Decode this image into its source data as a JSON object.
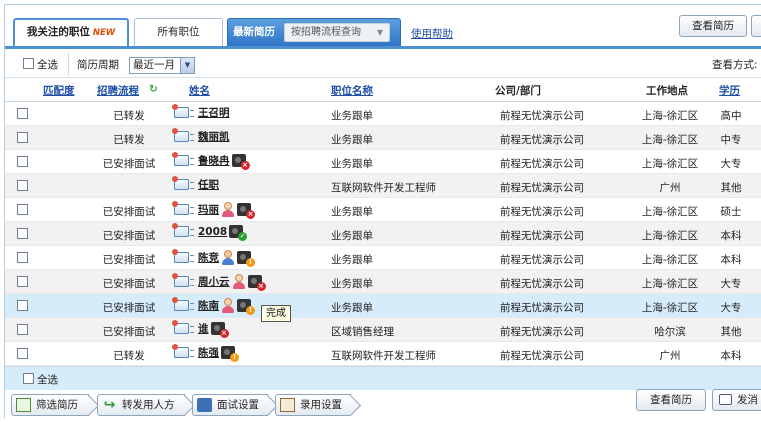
{
  "tabs": {
    "watched": {
      "label": "我关注的职位",
      "badge": "NEW"
    },
    "all": {
      "label": "所有职位"
    },
    "latest": {
      "label": "最新简历",
      "process_select": "按招聘流程查询"
    },
    "help": "使用帮助"
  },
  "top_buttons": {
    "view_resume": "查看简历"
  },
  "toolbar": {
    "select_all": "全选",
    "period_label": "简历周期",
    "period_value": "最近一月",
    "view_mode_label": "查看方式:"
  },
  "table": {
    "headers": {
      "match": "匹配度",
      "process": "招聘流程",
      "name": "姓名",
      "position": "职位名称",
      "company": "公司/部门",
      "location": "工作地点",
      "education": "学历"
    },
    "rows": [
      {
        "status": "已转发",
        "name": "王召明",
        "icons": [],
        "position": "业务跟单",
        "company": "前程无忧演示公司",
        "location": "上海-徐汇区",
        "education": "高中"
      },
      {
        "status": "已转发",
        "name": "魏丽凯",
        "icons": [],
        "position": "业务跟单",
        "company": "前程无忧演示公司",
        "location": "上海-徐汇区",
        "education": "中专"
      },
      {
        "status": "已安排面试",
        "name": "鲁晓冉",
        "icons": [
          "camera-red"
        ],
        "position": "业务跟单",
        "company": "前程无忧演示公司",
        "location": "上海-徐汇区",
        "education": "大专"
      },
      {
        "status": "",
        "name": "任职",
        "icons": [],
        "position": "互联网软件开发工程师",
        "company": "前程无忧演示公司",
        "location": "广州",
        "education": "其他"
      },
      {
        "status": "已安排面试",
        "name": "玛丽",
        "icons": [
          "person-girl",
          "camera-red"
        ],
        "position": "业务跟单",
        "company": "前程无忧演示公司",
        "location": "上海-徐汇区",
        "education": "硕士"
      },
      {
        "status": "已安排面试",
        "name": "2008",
        "icons": [
          "camera-green"
        ],
        "position": "业务跟单",
        "company": "前程无忧演示公司",
        "location": "上海-徐汇区",
        "education": "本科"
      },
      {
        "status": "已安排面试",
        "name": "陈竞",
        "icons": [
          "person-boy",
          "camera-orange"
        ],
        "position": "业务跟单",
        "company": "前程无忧演示公司",
        "location": "上海-徐汇区",
        "education": "本科"
      },
      {
        "status": "已安排面试",
        "name": "周小云",
        "icons": [
          "person-girl",
          "camera-red"
        ],
        "position": "业务跟单",
        "company": "前程无忧演示公司",
        "location": "上海-徐汇区",
        "education": "大专"
      },
      {
        "status": "已安排面试",
        "name": "陈南",
        "icons": [
          "person-girl",
          "camera-orange"
        ],
        "position": "业务跟单",
        "company": "前程无忧演示公司",
        "location": "上海-徐汇区",
        "education": "大专"
      },
      {
        "status": "已安排面试",
        "name": "谁",
        "icons": [
          "camera-red"
        ],
        "position": "区域销售经理",
        "company": "前程无忧演示公司",
        "location": "哈尔滨",
        "education": "其他"
      },
      {
        "status": "已转发",
        "name": "陈强",
        "icons": [
          "camera-orange"
        ],
        "position": "互联网软件开发工程师",
        "company": "前程无忧演示公司",
        "location": "广州",
        "education": "本科"
      }
    ],
    "highlighted_row": 8,
    "tooltip": "完成"
  },
  "footer": {
    "select_all": "全选"
  },
  "actions": {
    "filter": "筛选简历",
    "forward": "转发用人方",
    "interview": "面试设置",
    "hire": "录用设置",
    "view_resume": "查看简历",
    "send": "发消"
  },
  "colors": {
    "accent": "#2f73c4",
    "highlight_row": "#d7ecfb",
    "link": "#1f4fa8",
    "new_badge": "#e04a00"
  }
}
